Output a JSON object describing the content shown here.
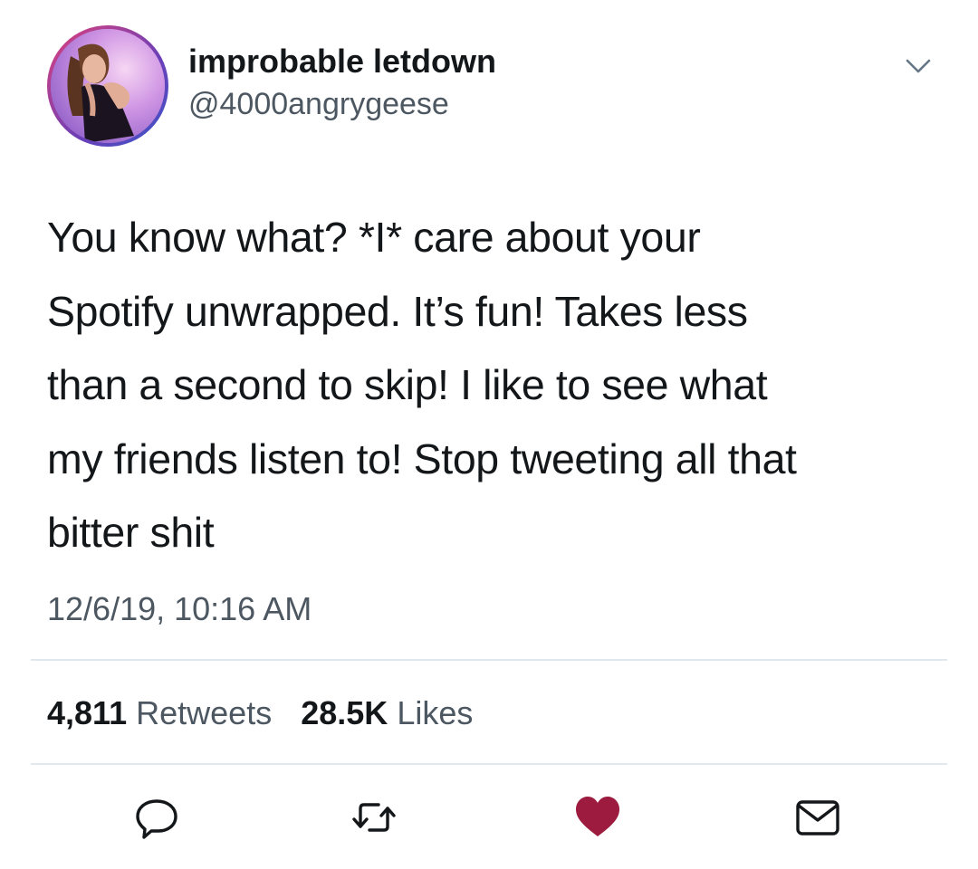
{
  "user": {
    "display_name": "improbable letdown",
    "handle": "@4000angrygeese",
    "avatar_icon": "profile-photo"
  },
  "tweet": {
    "lines": [
      "You know what? *I* care about your",
      "Spotify unwrapped. It’s fun! Takes less",
      "than a second to skip! I like to see what",
      "my friends listen to! Stop tweeting all that",
      "bitter shit"
    ],
    "timestamp": "12/6/19, 10:16 AM"
  },
  "stats": {
    "retweets_count": "4,811",
    "retweets_label": "Retweets",
    "likes_count": "28.5K",
    "likes_label": "Likes"
  },
  "actions": [
    {
      "name": "reply",
      "icon": "speech-bubble-icon"
    },
    {
      "name": "retweet",
      "icon": "retweet-arrows-icon"
    },
    {
      "name": "like",
      "icon": "heart-icon",
      "state": "liked"
    },
    {
      "name": "direct-message",
      "icon": "envelope-icon"
    }
  ],
  "colors": {
    "text_primary": "#14171a",
    "text_secondary": "#4c5761",
    "divider": "#e1e8ed",
    "like_active": "#9c1b3f",
    "icon_gray": "#657786"
  }
}
